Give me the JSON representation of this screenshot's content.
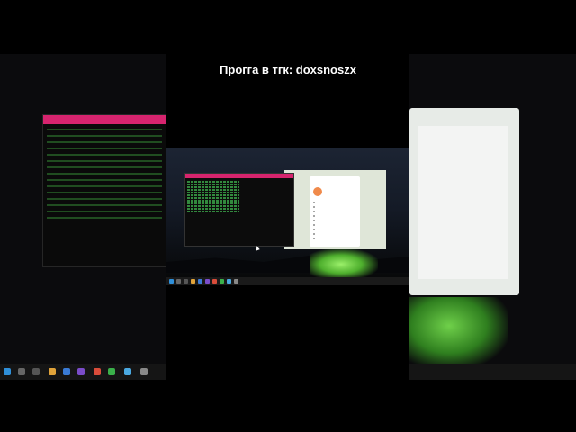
{
  "caption": "Прогга в тгк: doxsnoszx",
  "terminal": {
    "title": "",
    "line1": "",
    "line2": "",
    "rows_count": 12
  },
  "telegram": {
    "title": "",
    "user_name": "",
    "menu_items": [
      "",
      "",
      "",
      "",
      "",
      "",
      "",
      "",
      ""
    ],
    "bottom_link": ""
  },
  "taskbar": {
    "time": "",
    "date": ""
  },
  "colors": {
    "terminal_titlebar": "#d6246e",
    "terminal_text": "#3fb34f",
    "telegram_avatar": "#f08a4b",
    "tent_glow": "#6fd04a"
  }
}
